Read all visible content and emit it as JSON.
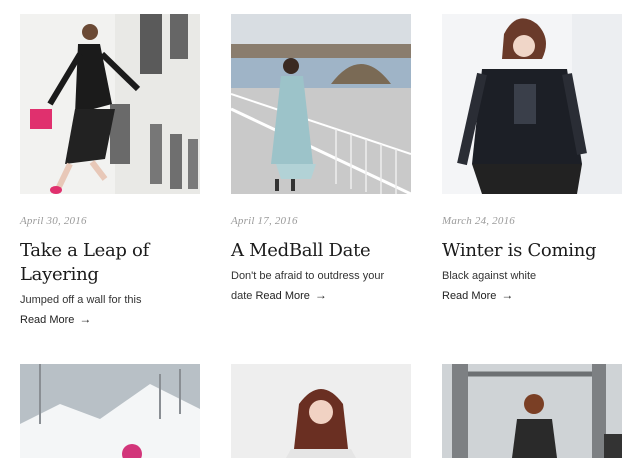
{
  "posts": [
    {
      "date": "April 30, 2016",
      "title_line1": "Take a Leap of",
      "title_line2": "Layering",
      "excerpt": "Jumped off a wall for this",
      "read_more": "Read More",
      "arrow": "→"
    },
    {
      "date": "April 17, 2016",
      "title_line1": "A MedBall Date",
      "excerpt_line1": "Don't be afraid to outdress your",
      "excerpt_line2": "date",
      "read_more": "Read More",
      "arrow": "→"
    },
    {
      "date": "March 24, 2016",
      "title_line1": "Winter is Coming",
      "excerpt": "Black against white",
      "read_more": "Read More",
      "arrow": "→"
    }
  ],
  "colors": {
    "date": "#9a9a9a",
    "title": "#1a1a1a",
    "text": "#333333"
  }
}
